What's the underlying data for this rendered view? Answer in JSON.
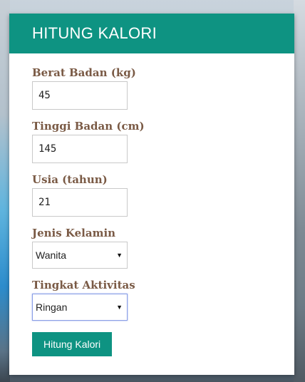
{
  "header": {
    "title": "HITUNG KALORI"
  },
  "form": {
    "weight": {
      "label": "Berat Badan (kg)",
      "value": "45"
    },
    "height": {
      "label": "Tinggi Badan (cm)",
      "value": "145"
    },
    "age": {
      "label": "Usia (tahun)",
      "value": "21"
    },
    "gender": {
      "label": "Jenis Kelamin",
      "selected": "Wanita"
    },
    "activity": {
      "label": "Tingkat Aktivitas",
      "selected": "Ringan"
    },
    "submit_label": "Hitung Kalori"
  },
  "colors": {
    "accent": "#0e9382",
    "label_text": "#7a5a45"
  }
}
